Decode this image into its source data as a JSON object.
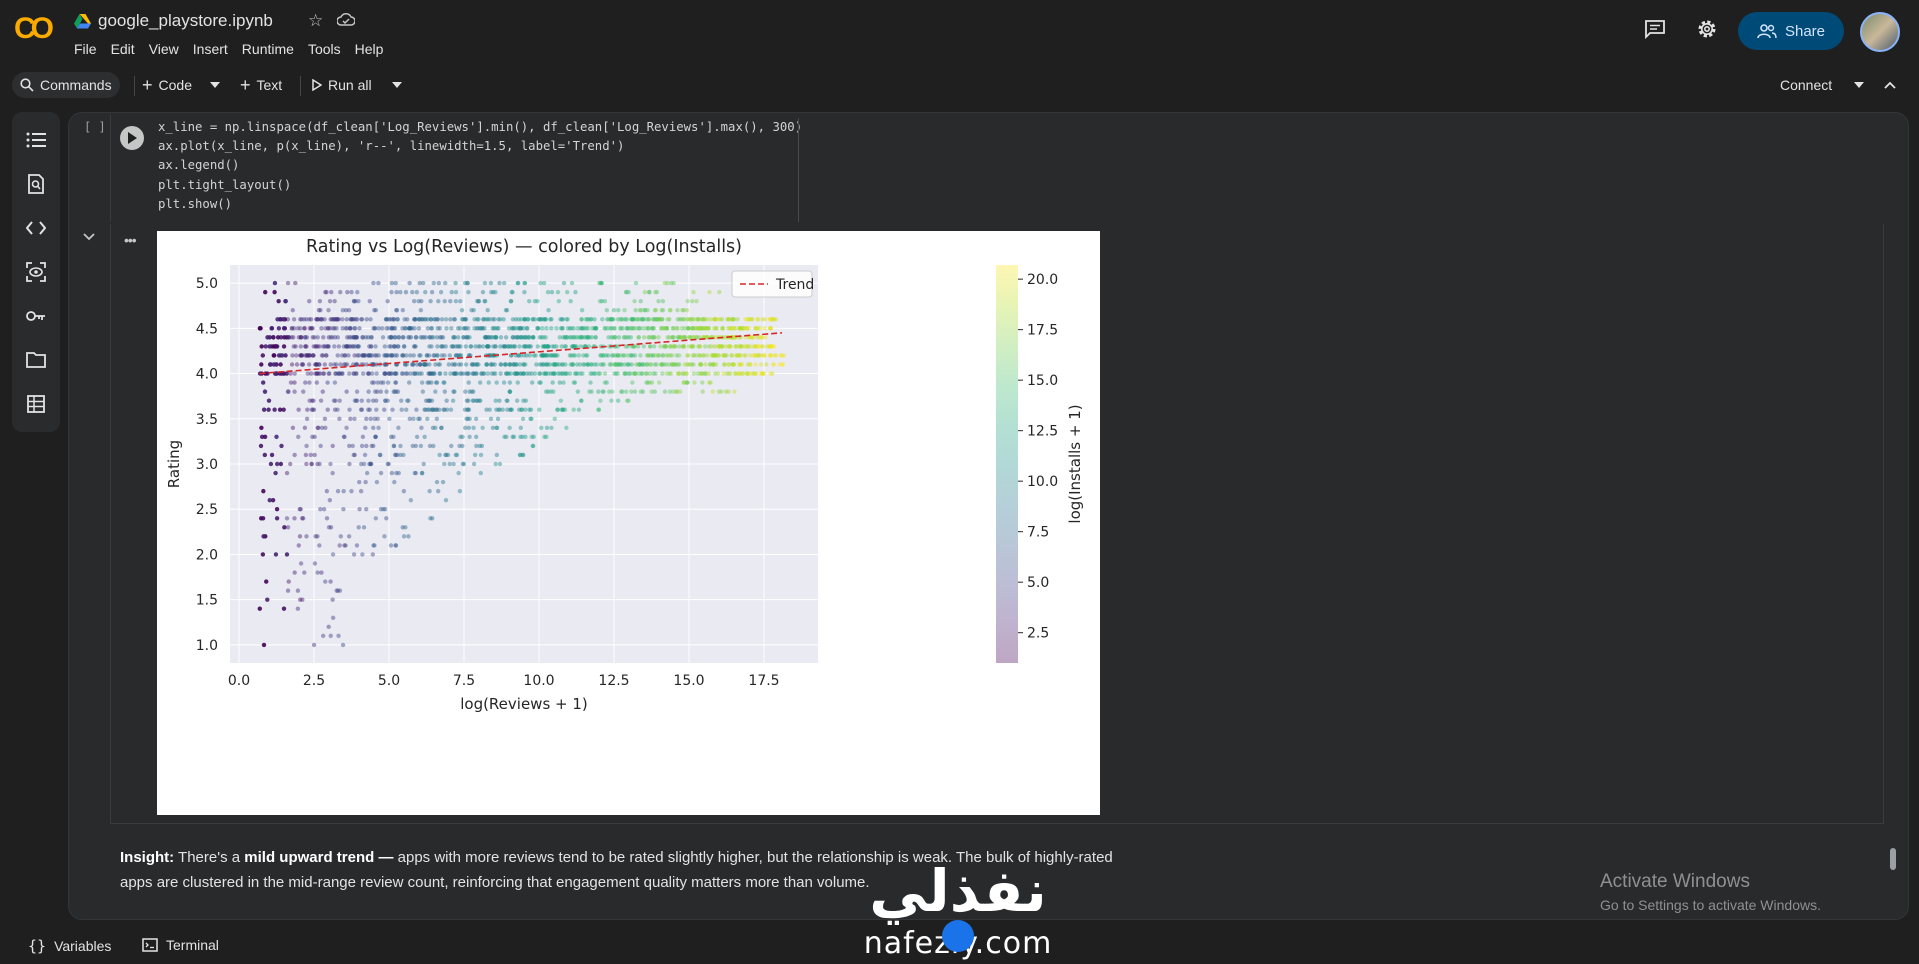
{
  "app": {
    "logo_text": "CO",
    "filename": "google_playstore.ipynb",
    "menu": [
      "File",
      "Edit",
      "View",
      "Insert",
      "Runtime",
      "Tools",
      "Help"
    ],
    "share_label": "Share"
  },
  "toolbar": {
    "commands_label": "Commands",
    "code_label": "Code",
    "text_label": "Text",
    "run_all_label": "Run all",
    "connect_label": "Connect"
  },
  "cell": {
    "bracket": "[ ]",
    "code_lines": [
      "x_line = np.linspace(df_clean['Log_Reviews'].min(), df_clean['Log_Reviews'].max(), 300)",
      "ax.plot(x_line, p(x_line), 'r--', linewidth=1.5, label='Trend')",
      "ax.legend()",
      "plt.tight_layout()",
      "plt.show()"
    ]
  },
  "chart_data": {
    "type": "scatter",
    "title": "Rating vs Log(Reviews) — colored by Log(Installs)",
    "xlabel": "log(Reviews + 1)",
    "ylabel": "Rating",
    "xlim": [
      -0.3,
      19.3
    ],
    "ylim": [
      0.8,
      5.2
    ],
    "x_ticks": [
      "0.0",
      "2.5",
      "5.0",
      "7.5",
      "10.0",
      "12.5",
      "15.0",
      "17.5"
    ],
    "y_ticks": [
      "1.0",
      "1.5",
      "2.0",
      "2.5",
      "3.0",
      "3.5",
      "4.0",
      "4.5",
      "5.0"
    ],
    "grid": true,
    "legend": {
      "entries": [
        "Trend"
      ],
      "placement": "top-right"
    },
    "colorbar": {
      "label": "log(Installs + 1)",
      "ticks": [
        "2.5",
        "5.0",
        "7.5",
        "10.0",
        "12.5",
        "15.0",
        "17.5",
        "20.0"
      ],
      "range": [
        1.0,
        20.7
      ],
      "colormap": "viridis"
    },
    "trend": {
      "name": "Trend",
      "color": "#d62728",
      "style": "dashed",
      "x": [
        0.69,
        18.1
      ],
      "y": [
        4.0,
        4.45
      ]
    },
    "scatter_summary": "dense horizontal bands at rating values 1.0 to 5.0 in 0.1 steps, x from 0.7 to 18"
  },
  "insight": {
    "label": "Insight:",
    "text_1": " There's a ",
    "bold_1": "mild upward trend —",
    "text_2": " apps with more reviews tend to be rated slightly higher, but the relationship is weak. The bulk of highly-rated apps are clustered in the mid-range review count, reinforcing that engagement quality matters more than volume."
  },
  "activate": {
    "title": "Activate Windows",
    "subtitle": "Go to Settings to activate Windows."
  },
  "bottom": {
    "variables_label": "Variables",
    "terminal_label": "Terminal"
  },
  "watermark": {
    "arabic": "نفذلي",
    "latin": "nafezly.com"
  },
  "colors": {
    "accent": "#f9ab00",
    "share_bg": "#004a77",
    "trend": "#d62728"
  }
}
